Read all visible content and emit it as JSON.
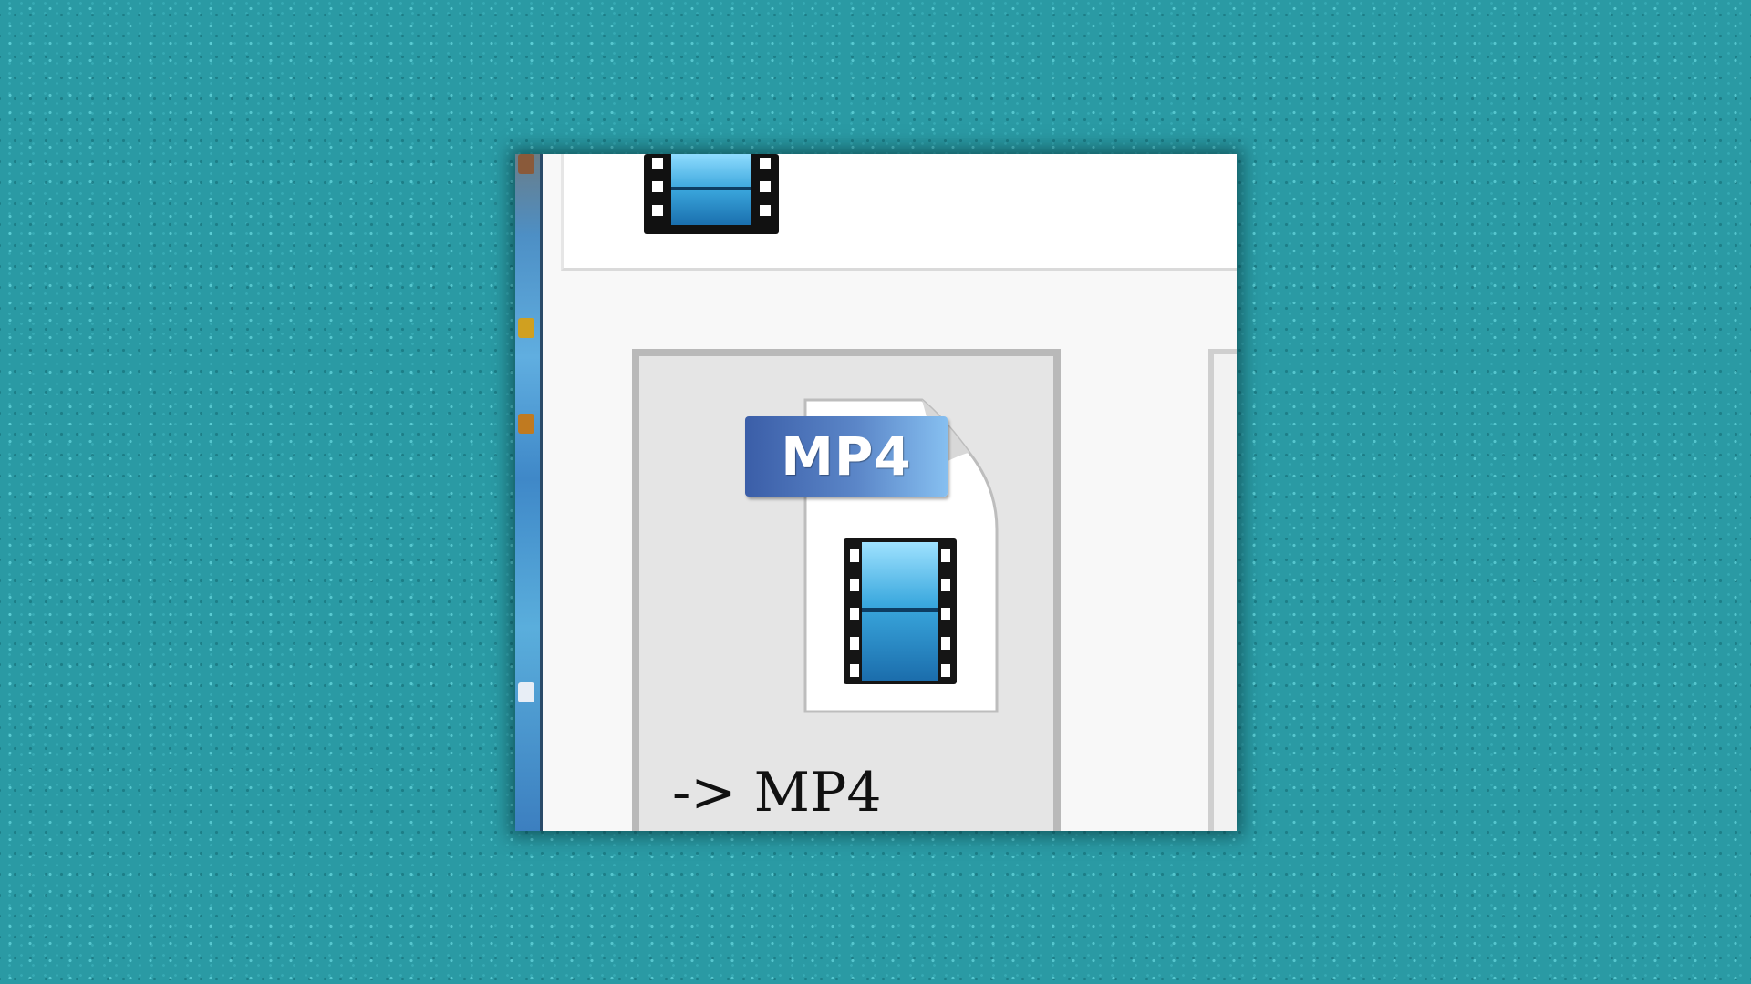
{
  "format_option": {
    "badge": "MP4",
    "caption": "-> MP4",
    "icon": "video-file-icon"
  },
  "top_panel": {
    "icon": "film-strip-icon"
  },
  "colors": {
    "desktop": "#2a9aa4",
    "badge": "#4a72b8",
    "film_blue": "#4fb6e6",
    "card": "#e5e5e5"
  }
}
